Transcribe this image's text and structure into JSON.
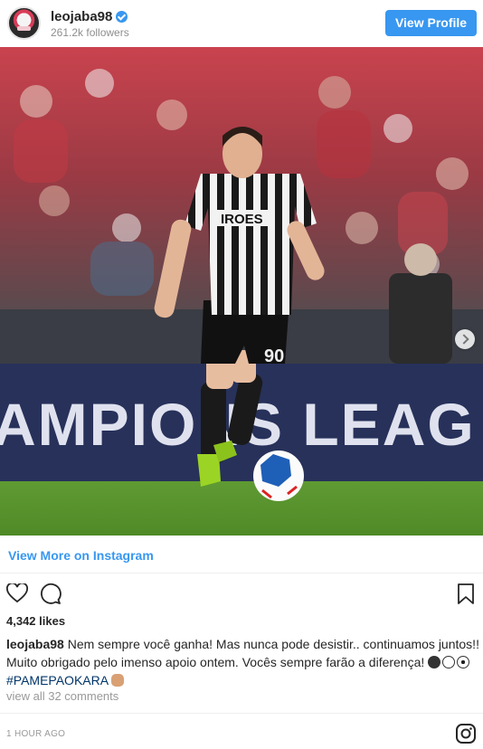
{
  "header": {
    "username": "leojaba98",
    "followers": "261.2k followers",
    "view_profile_label": "View Profile"
  },
  "post": {
    "banner_text": "AMPIONS LEAG",
    "shirt_sponsor": "IROES",
    "shorts_number": "90"
  },
  "links": {
    "view_more": "View More on Instagram"
  },
  "actions": {
    "likes": "4,342 likes"
  },
  "caption": {
    "username": "leojaba98",
    "line1": " Nem sempre você ganha! Mas nunca pode desistir.. continuamos juntos!!",
    "line2": "Muito obrigado pelo imenso apoio ontem. Vocês sempre farão a diferença!",
    "hashtag": "#PAMEPAOKARA",
    "view_comments": "view all 32 comments"
  },
  "footer": {
    "timestamp": "1 HOUR AGO"
  },
  "icons": [
    "verified-badge-icon",
    "next-arrow-icon",
    "heart-icon",
    "comment-icon",
    "bookmark-icon",
    "instagram-logo-icon"
  ],
  "colors": {
    "accent": "#3897f0",
    "hashtag": "#003569",
    "muted": "#8e8e8e"
  }
}
